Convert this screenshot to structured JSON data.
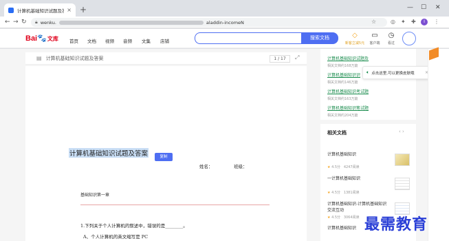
{
  "browser": {
    "tab_title": "计算机基础知识试题及答案 - 百",
    "tab_close": "×",
    "new_tab": "+",
    "win_min": "—",
    "win_max": "☐",
    "win_close": "✕",
    "url_prefix": "wenku.",
    "url_suffix": "aladdin-incomeN",
    "profile_initial": "I"
  },
  "site": {
    "logo_text": "Bai",
    "logo_paw": "🐾",
    "logo_suffix": "文库",
    "nav": [
      "首页",
      "文档",
      "视频",
      "音频",
      "文集",
      "店铺"
    ],
    "search_button": "搜索文档",
    "tools": [
      {
        "icon": "◇",
        "label": "新客立减5元"
      },
      {
        "icon": "▭",
        "label": "客户端"
      },
      {
        "icon": "◷",
        "label": "看过"
      }
    ]
  },
  "doc": {
    "toolbar_title": "计算机基础知识试题及答案",
    "page_indicator": "1 / 17",
    "title": "计算机基础知识试题及答案",
    "copy_button": "复制",
    "name_label": "姓名：",
    "class_label": "班级：",
    "chapter": "基础知识第一章",
    "question_1": "1.下列关于个人计算机的叙述中，错误的是________。",
    "question_1_option_a": "A、个人计算机的英文缩写是 PC"
  },
  "sidebar": {
    "top_links": [
      {
        "title": "计算机基础知识试题及",
        "meta": "相关文档约168万篇"
      },
      {
        "title": "计算机基础知识识",
        "meta": "相关文档约146万篇"
      },
      {
        "title": "计算机基础知识考试题",
        "meta": "相关文档约163万篇"
      },
      {
        "title": "计算机基础知识笔试题",
        "meta": "相关文档约204万篇"
      }
    ],
    "popover_text": "点击这里,可以更换皮肤哦",
    "popover_close": "×",
    "related_heading": "相关文档",
    "related": [
      {
        "title": "计算机基础知识",
        "score": "4.5分",
        "reads": "4247阅读"
      },
      {
        "title": "一计算机基础知识",
        "score": "4.5分",
        "reads": "1381阅读"
      },
      {
        "title": "计算机基础知识-计算机基础知识交流互动",
        "score": "4.5分",
        "reads": "3064阅读"
      },
      {
        "title": "计算机基础知识",
        "score": "",
        "reads": ""
      }
    ]
  },
  "watermark": "最需教育"
}
